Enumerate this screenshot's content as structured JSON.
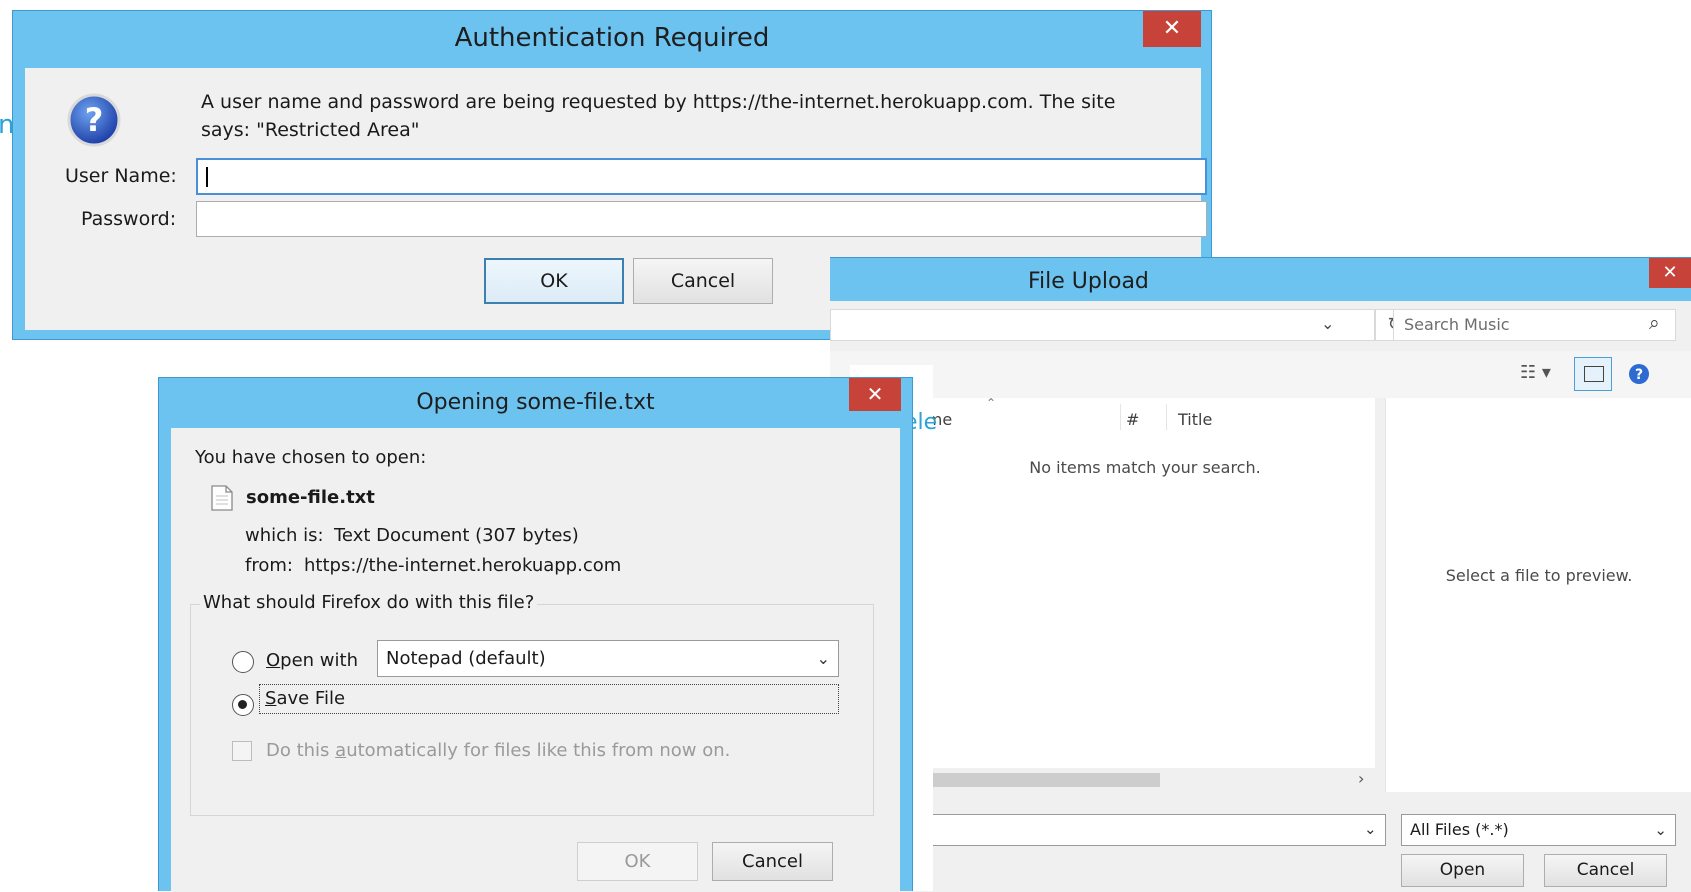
{
  "background": {
    "fragment_left": "n",
    "fragment_mid": "ele"
  },
  "auth": {
    "title": "Authentication Required",
    "message_line1": "A user name and password are being requested by https://the-internet.herokuapp.com. The site",
    "message_line2": "says: \"Restricted Area\"",
    "username_label": "User Name:",
    "username_value": "",
    "password_label": "Password:",
    "password_value": "",
    "ok_label": "OK",
    "cancel_label": "Cancel",
    "close_glyph": "✕"
  },
  "upload": {
    "title": "File Upload",
    "search_placeholder": "Search Music",
    "columns": [
      "Name",
      "#",
      "Title"
    ],
    "empty_message": "No items match your search.",
    "preview_message": "Select a file to preview.",
    "filetype_value": "All Files (*.*)",
    "open_label": "Open",
    "cancel_label": "Cancel",
    "close_glyph": "✕"
  },
  "opening": {
    "title": "Opening some-file.txt",
    "chosen_label": "You have chosen to open:",
    "file_name": "some-file.txt",
    "which_is_label": "which is:",
    "which_is_value": "Text Document (307 bytes)",
    "from_label": "from:",
    "from_value": "https://the-internet.herokuapp.com",
    "group_label": "What should Firefox do with this file?",
    "open_with_prefix": "O",
    "open_with_rest": "pen with",
    "app_value": "Notepad (default)",
    "save_prefix": "S",
    "save_rest": "ave File",
    "auto_pre": "Do this ",
    "auto_key": "a",
    "auto_post": "utomatically for files like this from now on.",
    "ok_label": "OK",
    "cancel_label": "Cancel",
    "close_glyph": "✕",
    "selected_action": "save"
  }
}
